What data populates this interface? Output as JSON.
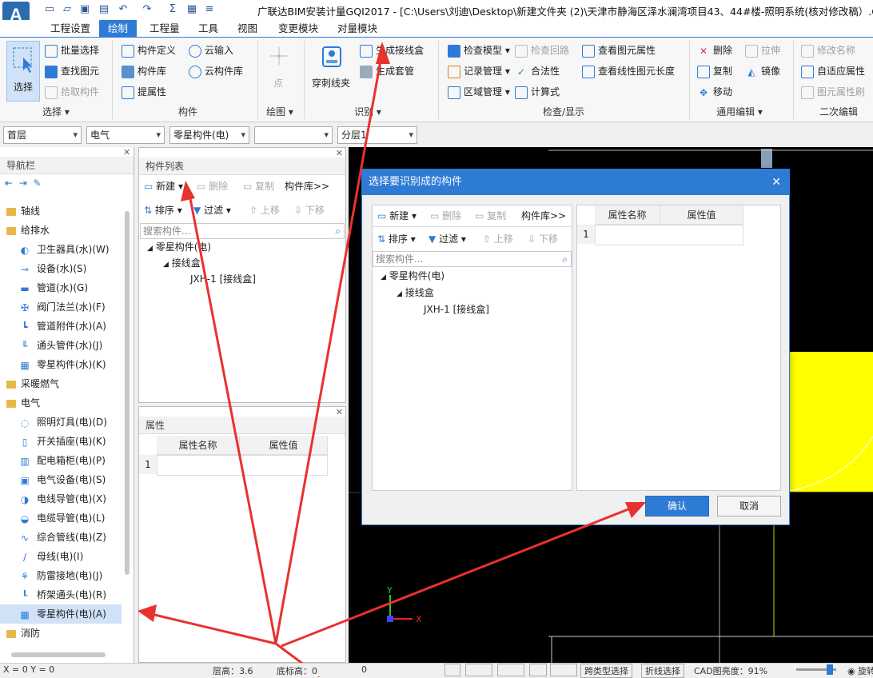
{
  "app": {
    "title": "广联达BIM安装计量GQI2017 - [C:\\Users\\刘迪\\Desktop\\新建文件夹 (2)\\天津市静海区泽水澜湾项目43、44#楼-照明系统(核对修改稿）.GQI"
  },
  "menu": [
    "工程设置",
    "绘制",
    "工程量",
    "工具",
    "视图",
    "变更模块",
    "对量模块"
  ],
  "menu_active": 1,
  "ribbon": {
    "select": {
      "big": "选择",
      "items": [
        "批量选择",
        "查找图元",
        "拾取构件"
      ],
      "group": "选择"
    },
    "component": {
      "items": [
        "构件定义",
        "构件库",
        "提属性",
        "云输入",
        "云构件库"
      ],
      "group": "构件"
    },
    "draw": {
      "point": "点",
      "group": "绘图"
    },
    "identify": {
      "items": [
        "穿刺线夹",
        "生成接线盒",
        "生成套管"
      ],
      "group": "识别"
    },
    "check": {
      "items": [
        "检查模型",
        "记录管理",
        "区域管理",
        "检查回路",
        "合法性",
        "计算式",
        "查看图元属性",
        "查看线性图元长度"
      ],
      "group": "检查/显示"
    },
    "edit": {
      "items": [
        "删除",
        "复制",
        "移动",
        "拉伸",
        "镜像"
      ],
      "group": "通用编辑"
    },
    "edit2": {
      "items": [
        "修改名称",
        "自适应属性",
        "图元属性刷"
      ],
      "group": "二次编辑"
    }
  },
  "toolbar2": {
    "floor": "首层",
    "discipline": "电气",
    "type": "零星构件(电)",
    "blank": "",
    "layer": "分层1"
  },
  "nav": {
    "title": "导航栏",
    "groups": [
      {
        "label": "轴线",
        "type": "folder"
      },
      {
        "label": "给排水",
        "type": "folder"
      },
      {
        "label": "卫生器具(水)(W)",
        "type": "leaf"
      },
      {
        "label": "设备(水)(S)",
        "type": "leaf"
      },
      {
        "label": "管道(水)(G)",
        "type": "leaf"
      },
      {
        "label": "阀门法兰(水)(F)",
        "type": "leaf"
      },
      {
        "label": "管道附件(水)(A)",
        "type": "leaf"
      },
      {
        "label": "通头管件(水)(J)",
        "type": "leaf"
      },
      {
        "label": "零星构件(水)(K)",
        "type": "leaf"
      },
      {
        "label": "采暖燃气",
        "type": "folder"
      },
      {
        "label": "电气",
        "type": "folder"
      },
      {
        "label": "照明灯具(电)(D)",
        "type": "leaf"
      },
      {
        "label": "开关插座(电)(K)",
        "type": "leaf"
      },
      {
        "label": "配电箱柜(电)(P)",
        "type": "leaf"
      },
      {
        "label": "电气设备(电)(S)",
        "type": "leaf"
      },
      {
        "label": "电线导管(电)(X)",
        "type": "leaf"
      },
      {
        "label": "电缆导管(电)(L)",
        "type": "leaf"
      },
      {
        "label": "综合管线(电)(Z)",
        "type": "leaf"
      },
      {
        "label": "母线(电)(I)",
        "type": "leaf"
      },
      {
        "label": "防雷接地(电)(J)",
        "type": "leaf"
      },
      {
        "label": "桥架通头(电)(R)",
        "type": "leaf"
      },
      {
        "label": "零星构件(电)(A)",
        "type": "leaf"
      },
      {
        "label": "消防",
        "type": "folder"
      }
    ]
  },
  "complist": {
    "title": "构件列表",
    "toolbar1": [
      "新建",
      "删除",
      "复制",
      "构件库>>"
    ],
    "toolbar2": [
      "排序",
      "过滤",
      "上移",
      "下移"
    ],
    "search_placeholder": "搜索构件...",
    "tree": [
      "零星构件(电)",
      "接线盒",
      "JXH-1 [接线盒]"
    ]
  },
  "props": {
    "title": "属性",
    "col1": "属性名称",
    "col2": "属性值",
    "row": "1"
  },
  "dialog": {
    "title": "选择要识别成的构件",
    "toolbar1": [
      "新建",
      "删除",
      "复制",
      "构件库>>"
    ],
    "toolbar2": [
      "排序",
      "过滤",
      "上移",
      "下移"
    ],
    "search_placeholder": "搜索构件...",
    "tree": [
      "零星构件(电)",
      "接线盒",
      "JXH-1 [接线盒]"
    ],
    "col1": "属性名称",
    "col2": "属性值",
    "row": "1",
    "ok": "确认",
    "cancel": "取消"
  },
  "status": {
    "coord": "X = 0 Y = 0",
    "floor_h": "层高：3.6",
    "base_h": "底标高：0",
    "zero": "0",
    "btn1": "跨类型选择",
    "btn2": "折线选择",
    "cad": "CAD图亮度：91%",
    "last": "旋转"
  },
  "colors": {
    "accent": "#2e7bd6",
    "arrow": "#e8322e",
    "cad_fill": "#ffff00"
  }
}
